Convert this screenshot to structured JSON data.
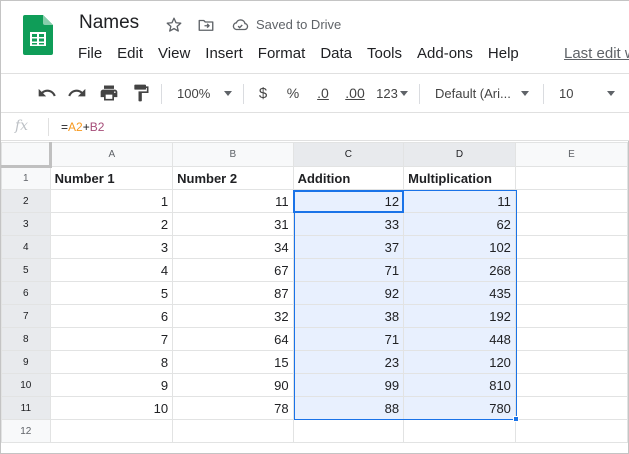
{
  "doc": {
    "title": "Names",
    "saved_status": "Saved to Drive"
  },
  "menu": [
    "File",
    "Edit",
    "View",
    "Insert",
    "Format",
    "Data",
    "Tools",
    "Add-ons",
    "Help"
  ],
  "last_edit": "Last edit w",
  "toolbar": {
    "zoom": "100%",
    "currency": "$",
    "percent": "%",
    "dec_decrease": ".0",
    "dec_increase": ".00",
    "more_formats": "123",
    "font": "Default (Ari...",
    "font_size": "10"
  },
  "formula_bar": {
    "fx": "fx",
    "eq": "=",
    "ref1": "A2",
    "op": "+",
    "ref2": "B2"
  },
  "grid": {
    "columns": [
      "A",
      "B",
      "C",
      "D",
      "E"
    ],
    "rows": [
      {
        "n": "1",
        "cells": [
          "Number 1",
          "Number 2",
          "Addition",
          "Multiplication",
          ""
        ]
      },
      {
        "n": "2",
        "cells": [
          "1",
          "11",
          "12",
          "11",
          ""
        ]
      },
      {
        "n": "3",
        "cells": [
          "2",
          "31",
          "33",
          "62",
          ""
        ]
      },
      {
        "n": "4",
        "cells": [
          "3",
          "34",
          "37",
          "102",
          ""
        ]
      },
      {
        "n": "5",
        "cells": [
          "4",
          "67",
          "71",
          "268",
          ""
        ]
      },
      {
        "n": "6",
        "cells": [
          "5",
          "87",
          "92",
          "435",
          ""
        ]
      },
      {
        "n": "7",
        "cells": [
          "6",
          "32",
          "38",
          "192",
          ""
        ]
      },
      {
        "n": "8",
        "cells": [
          "7",
          "64",
          "71",
          "448",
          ""
        ]
      },
      {
        "n": "9",
        "cells": [
          "8",
          "15",
          "23",
          "120",
          ""
        ]
      },
      {
        "n": "10",
        "cells": [
          "9",
          "90",
          "99",
          "810",
          ""
        ]
      },
      {
        "n": "11",
        "cells": [
          "10",
          "78",
          "88",
          "780",
          ""
        ]
      },
      {
        "n": "12",
        "cells": [
          "",
          "",
          "",
          "",
          ""
        ]
      }
    ]
  },
  "colors": {
    "accent": "#1a73e8",
    "sheets_green": "#0f9d58",
    "selection": "#e8f0fe"
  }
}
